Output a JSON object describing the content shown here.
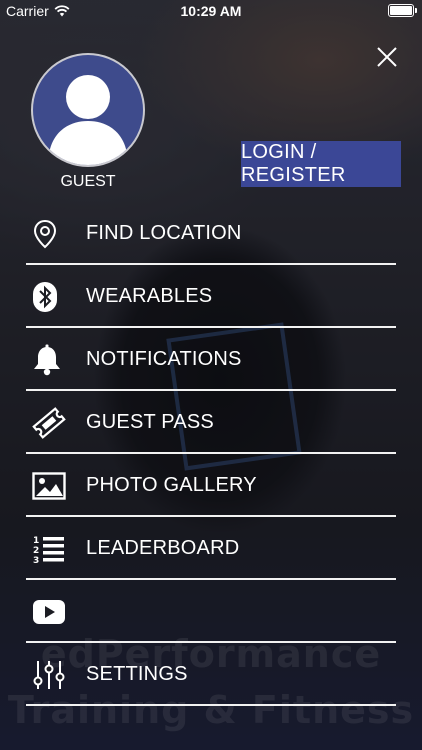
{
  "status_bar": {
    "carrier": "Carrier",
    "time": "10:29 AM"
  },
  "profile": {
    "name": "GUEST",
    "avatar_icon": "user-avatar-icon"
  },
  "login_button": {
    "label": "LOGIN / REGISTER"
  },
  "menu": {
    "items": [
      {
        "label": "FIND LOCATION",
        "icon": "location-pin-icon"
      },
      {
        "label": "WEARABLES",
        "icon": "bluetooth-icon"
      },
      {
        "label": "NOTIFICATIONS",
        "icon": "bell-icon"
      },
      {
        "label": "GUEST PASS",
        "icon": "ticket-icon"
      },
      {
        "label": "PHOTO GALLERY",
        "icon": "photo-icon"
      },
      {
        "label": "LEADERBOARD",
        "icon": "numbered-list-icon"
      },
      {
        "label": "",
        "icon": "youtube-icon"
      },
      {
        "label": "SETTINGS",
        "icon": "sliders-icon"
      }
    ]
  },
  "watermark": {
    "line1": "edPerformance",
    "line2": "Training & Fitness"
  },
  "colors": {
    "accent": "#3b4796",
    "avatar_bg": "#3e4b8c"
  }
}
